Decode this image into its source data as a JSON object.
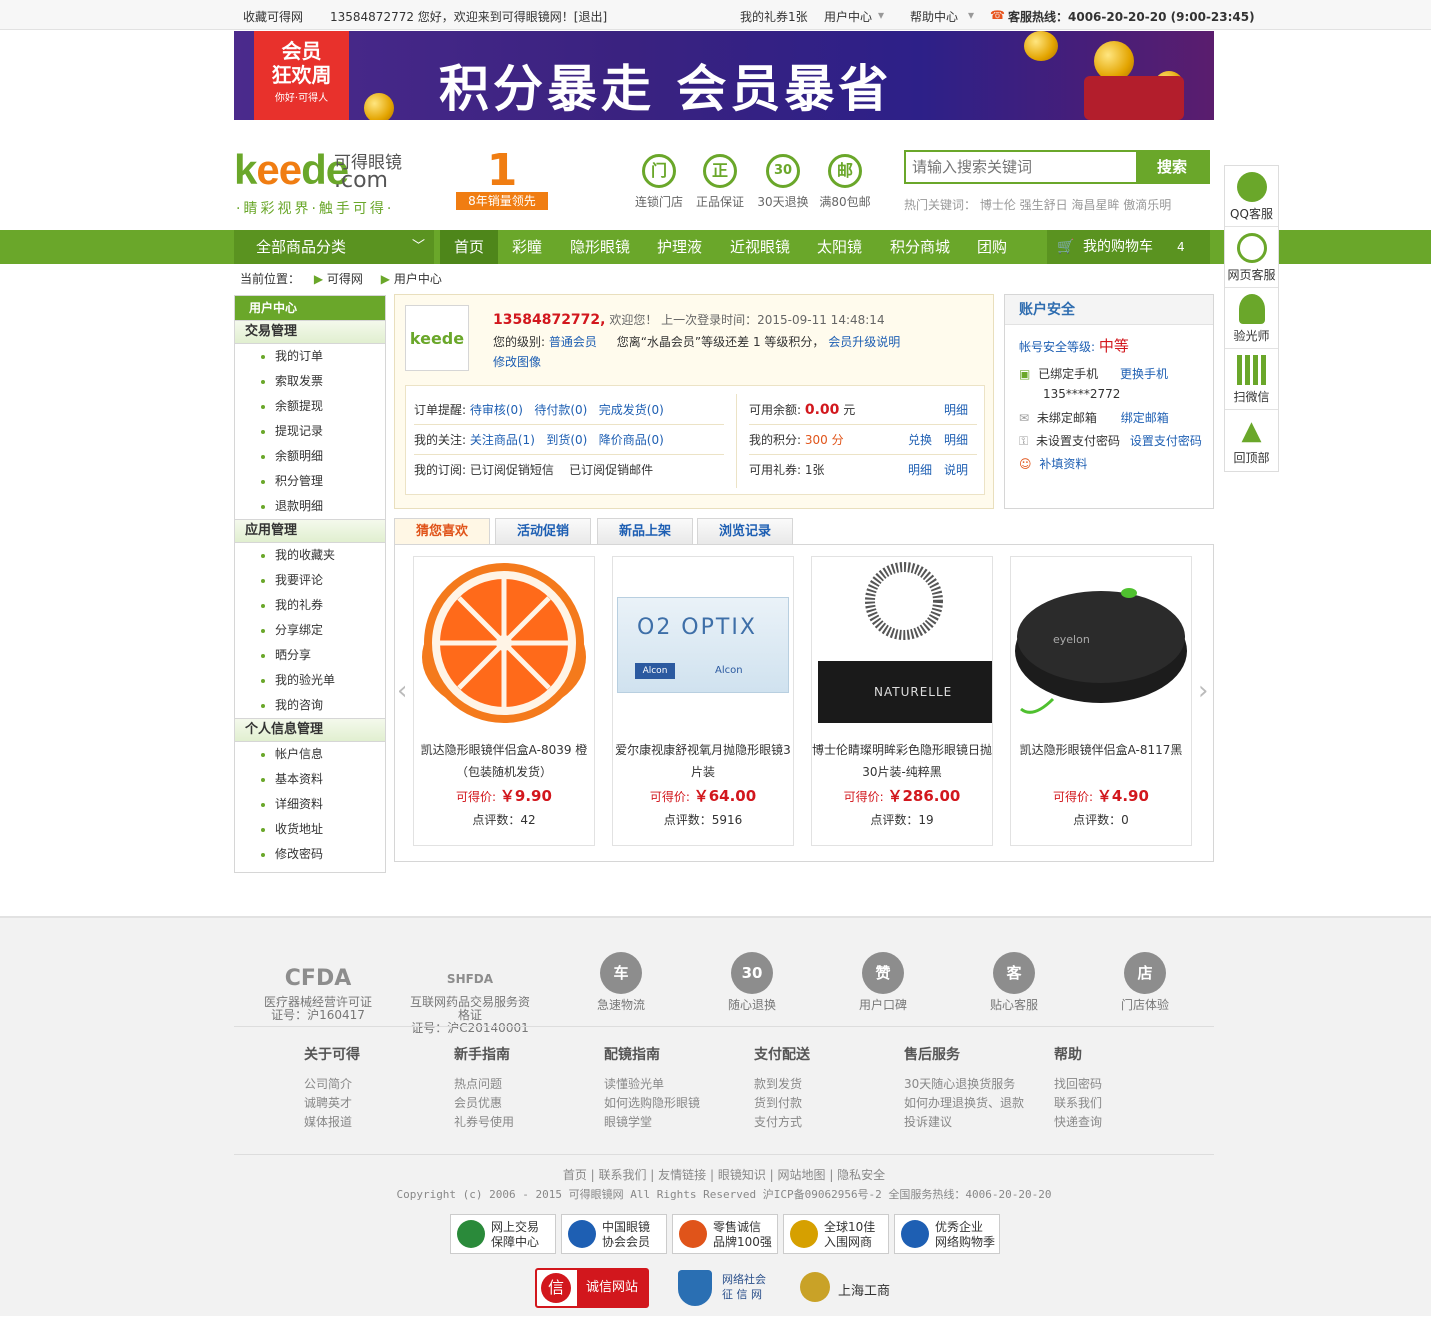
{
  "topbar": {
    "fav": "收藏可得网",
    "greeting": "13584872772 您好，欢迎来到可得眼镜网！[退出]",
    "gift": "我的礼券1张",
    "user_center": "用户中心",
    "help": "帮助中心",
    "hotline": "客服热线：4006-20-20-20 (9:00-23:45)"
  },
  "banner": {
    "tag_line1": "会员",
    "tag_line2": "狂欢周",
    "tag_sub": "你好·可得人",
    "text": "积分暴走  会员暴省"
  },
  "logo": {
    "brand_a": "k",
    "brand_b": "ee",
    "brand_c": "de",
    "cn": "可得眼镜",
    "com": ".com",
    "slogan": "·睛彩视界·触手可得·"
  },
  "award": {
    "num": "1",
    "label": "8年销量领先"
  },
  "services": [
    {
      "icon": "门",
      "label": "连锁门店"
    },
    {
      "icon": "正",
      "label": "正品保证"
    },
    {
      "icon": "30",
      "label": "30天退换"
    },
    {
      "icon": "邮",
      "label": "满80包邮"
    }
  ],
  "search": {
    "placeholder": "请输入搜索关键词",
    "button": "搜索",
    "hot": "热门关键词：  博士伦  强生舒日  海昌星眸  傲滴乐明"
  },
  "nav": {
    "all": "全部商品分类",
    "items": [
      "首页",
      "彩瞳",
      "隐形眼镜",
      "护理液",
      "近视眼镜",
      "太阳镜",
      "积分商城",
      "团购"
    ],
    "cart": "我的购物车",
    "cart_count": "4"
  },
  "breadcrumb": {
    "label": "当前位置：",
    "a": "可得网",
    "b": "用户中心"
  },
  "sidebar": {
    "head": "用户中心",
    "groups": [
      {
        "title": "交易管理",
        "items": [
          "我的订单",
          "索取发票",
          "余额提现",
          "提现记录",
          "余额明细",
          "积分管理",
          "退款明细"
        ]
      },
      {
        "title": "应用管理",
        "items": [
          "我的收藏夹",
          "我要评论",
          "我的礼券",
          "分享绑定",
          "晒分享",
          "我的验光单",
          "我的咨询"
        ]
      },
      {
        "title": "个人信息管理",
        "items": [
          "帐户信息",
          "基本资料",
          "详细资料",
          "收货地址",
          "修改密码"
        ]
      }
    ]
  },
  "userinfo": {
    "avatar": "keede",
    "phone": "13584872772,",
    "welcome": "欢迎您！ 上一次登录时间：2015-09-11 14:48:14",
    "level_label": "您的级别:",
    "level": "普通会员",
    "upgrade_text": "您离“水晶会员”等级还差 1 等级积分，",
    "upgrade_link": "会员升级说明",
    "edit_avatar": "修改图像",
    "order_label": "订单提醒:",
    "order_links": [
      "待审核(0)",
      "待付款(0)",
      "完成发货(0)"
    ],
    "follow_label": "我的关注:",
    "follow_links": [
      "关注商品(1)",
      "到货(0)",
      "降价商品(0)"
    ],
    "sub_label": "我的订阅:",
    "subs": [
      "已订阅促销短信",
      "已订阅促销邮件"
    ],
    "balance_label": "可用余额:",
    "balance": "0.00",
    "balance_unit": "元",
    "points_label": "我的积分:",
    "points": "300 分",
    "coupon_label": "可用礼券:",
    "coupon": "1张",
    "detail": "明细",
    "exchange": "兑换",
    "explain": "说明"
  },
  "account": {
    "title": "账户安全",
    "level_label": "帐号安全等级:",
    "level": "中等",
    "rows": [
      {
        "text": "已绑定手机",
        "link": "更换手机"
      },
      {
        "text": "未绑定邮箱",
        "link": "绑定邮箱"
      },
      {
        "text": "未设置支付密码",
        "link": "设置支付密码"
      },
      {
        "text": "",
        "link": "补填资料"
      }
    ],
    "masked_phone": "135****2772"
  },
  "tabs": [
    "猜您喜欢",
    "活动促销",
    "新品上架",
    "浏览记录"
  ],
  "products": [
    {
      "name": "凯达隐形眼镜伴侣盒A-8039 橙（包装随机发货）",
      "price_label": "可得价:",
      "price": "￥9.90",
      "score": "点评数：42"
    },
    {
      "name": "爱尔康视康舒视氧月抛隐形眼镜3片装",
      "price_label": "可得价:",
      "price": "￥64.00",
      "score": "点评数：5916",
      "box": "O2 OPTIX",
      "maker": "Alcon"
    },
    {
      "name": "博士伦睛璨明眸彩色隐形眼镜日抛30片装-纯粹黑",
      "price_label": "可得价:",
      "price": "￥286.00",
      "score": "点评数：19",
      "box": "NATURELLE"
    },
    {
      "name": "凯达隐形眼镜伴侣盒A-8117黑",
      "price_label": "可得价:",
      "price": "￥4.90",
      "score": "点评数：0",
      "box": "eyelon"
    }
  ],
  "float": [
    "QQ客服",
    "网页客服",
    "验光师",
    "扫微信",
    "回顶部"
  ],
  "footer": {
    "badges": [
      {
        "icon": "CFDA",
        "label": "医疗器械经营许可证\n证号：沪160417"
      },
      {
        "icon": "SHFDA",
        "label": "互联网药品交易服务资格证\n证号：沪C20140001"
      },
      {
        "icon": "车",
        "label": "急速物流"
      },
      {
        "icon": "30",
        "label": "随心退换"
      },
      {
        "icon": "赞",
        "label": "用户口碑"
      },
      {
        "icon": "客",
        "label": "贴心客服"
      },
      {
        "icon": "店",
        "label": "门店体验"
      }
    ],
    "cols": [
      {
        "title": "关于可得",
        "items": [
          "公司简介",
          "诚聘英才",
          "媒体报道"
        ]
      },
      {
        "title": "新手指南",
        "items": [
          "热点问题",
          "会员优惠",
          "礼券号使用"
        ]
      },
      {
        "title": "配镜指南",
        "items": [
          "读懂验光单",
          "如何选购隐形眼镜",
          "眼镜学堂"
        ]
      },
      {
        "title": "支付配送",
        "items": [
          "款到发货",
          "货到付款",
          "支付方式"
        ]
      },
      {
        "title": "售后服务",
        "items": [
          "30天随心退换货服务",
          "如何办理退换货、退款",
          "投诉建议"
        ]
      },
      {
        "title": "帮助",
        "items": [
          "找回密码",
          "联系我们",
          "快递查询"
        ]
      }
    ],
    "links": "首页 | 联系我们 | 友情链接 | 眼镜知识 | 网站地图 | 隐私安全",
    "copyright": "Copyright (c) 2006 - 2015 可得眼镜网 All Rights Reserved 沪ICP备09062956号-2 全国服务热线：4006-20-20-20",
    "seals": [
      "网上交易\n保障中心",
      "中国眼镜\n协会会员",
      "零售诚信\n品牌100强",
      "全球10佳\n入围网商",
      "优秀企业\n网络购物季"
    ],
    "seal2": [
      "诚信网站",
      "网络社会\n征 信 网",
      "上海工商"
    ]
  },
  "colors": {
    "green": "#6aa72a",
    "orange": "#f07d12",
    "red": "#d2171d",
    "link": "#1e5fb3"
  }
}
